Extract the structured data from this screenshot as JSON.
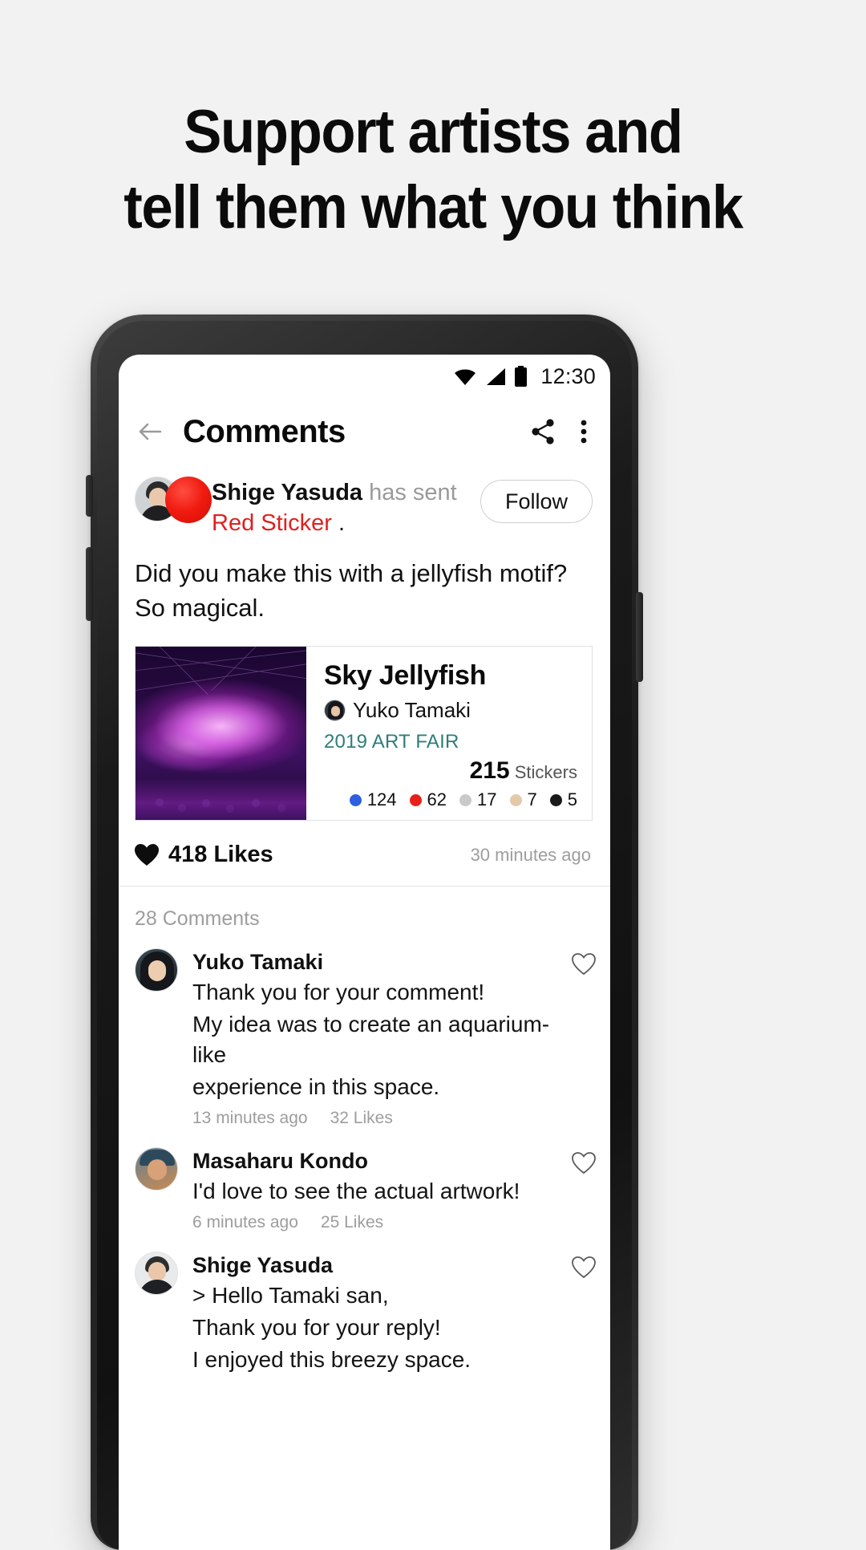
{
  "promo": {
    "headline_line1": "Support artists and",
    "headline_line2": "tell them what you think"
  },
  "status_bar": {
    "time": "12:30",
    "wifi_icon": "wifi-icon",
    "signal_icon": "signal-icon",
    "battery_icon": "battery-full-icon"
  },
  "app_bar": {
    "back_icon": "back-arrow-icon",
    "title": "Comments",
    "share_icon": "share-icon",
    "overflow_icon": "more-vertical-icon"
  },
  "notice": {
    "sender": "Shige Yasuda",
    "action": " has sent",
    "sticker": "Red Sticker",
    "period": " .",
    "follow_label": "Follow",
    "sticker_color": "#e8180c"
  },
  "comment": {
    "line1": "Did you make this with a jellyfish motif?",
    "line2": "So magical."
  },
  "artwork": {
    "title": "Sky Jellyfish",
    "artist": "Yuko Tamaki",
    "event": "2019 ART FAIR",
    "stickers_total": "215",
    "stickers_label": "Stickers",
    "sticker_counts": [
      {
        "color": "#2f5fe0",
        "count": "124"
      },
      {
        "color": "#e8201a",
        "count": "62"
      },
      {
        "color": "#c9c9c9",
        "count": "17"
      },
      {
        "color": "#e3c9a8",
        "count": "7"
      },
      {
        "color": "#1a1a1a",
        "count": "5"
      }
    ]
  },
  "likes": {
    "heart_icon": "heart-filled-icon",
    "count_text": "418 Likes",
    "time_ago": "30 minutes ago"
  },
  "comments_section": {
    "count_label": "28 Comments",
    "items": [
      {
        "name": "Yuko Tamaki",
        "lines": [
          "Thank you for your comment!",
          "My idea was to create an aquarium-like",
          "experience in this space."
        ],
        "time_ago": "13 minutes ago",
        "likes": "32 Likes",
        "avatar": "avatar-yuko-tamaki"
      },
      {
        "name": "Masaharu Kondo",
        "lines": [
          "I'd love to see the actual artwork!"
        ],
        "time_ago": "6 minutes ago",
        "likes": "25 Likes",
        "avatar": "avatar-masaharu-kondo"
      },
      {
        "name": "Shige Yasuda",
        "lines": [
          "> Hello Tamaki san,",
          "Thank you for your reply!",
          "I enjoyed this breezy space."
        ],
        "time_ago": "",
        "likes": "",
        "avatar": "avatar-shige-yasuda"
      }
    ]
  }
}
